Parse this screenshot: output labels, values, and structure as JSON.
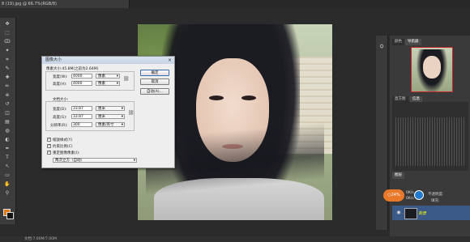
{
  "document": {
    "tab_title": "8 (19).jpg @ 66.7%(RGB/8)",
    "status_text": "文档:7.00M/7.00M"
  },
  "dialog": {
    "title": "图像大小",
    "close_label": "×",
    "pixel_dimensions_label": "像素大小:45.8M(之前为2.64M)",
    "width_label": "宽度(W):",
    "width_value": "4000",
    "width_unit": "像素",
    "height_label": "高度(H):",
    "height_value": "4000",
    "height_unit": "像素",
    "doc_size_label": "文档大小:",
    "doc_width_label": "宽度(D):",
    "doc_width_value": "33.87",
    "doc_width_unit": "厘米",
    "doc_height_label": "高度(G):",
    "doc_height_value": "33.87",
    "doc_height_unit": "厘米",
    "resolution_label": "分辨率(R):",
    "resolution_value": "300",
    "resolution_unit": "像素/英寸",
    "ok_label": "确定",
    "cancel_label": "取消",
    "auto_label": "自动(A)...",
    "scale_styles_label": "缩放样式(Y)",
    "constrain_label": "约束比例(C)",
    "resample_label": "重定图像像素(I):",
    "resample_method": "两次立方（自动）",
    "checked_mark": "✓"
  },
  "panels": {
    "tab_color": "颜色",
    "tab_navigator": "导航器",
    "tab_histogram": "直方图",
    "tab_info": "信息",
    "size_label": "大小:",
    "layers_tab": "图层",
    "layer_name": "背景",
    "opacity_label": "不透明度:",
    "fill_label": "填充:"
  },
  "badge": {
    "text": "○24%",
    "percent_top": "0K/s",
    "percent_bottom": "0K/s"
  },
  "tools": {
    "icons": [
      "move-icon",
      "marquee-icon",
      "lasso-icon",
      "wand-icon",
      "crop-icon",
      "eyedropper-icon",
      "heal-icon",
      "brush-icon",
      "stamp-icon",
      "history-brush-icon",
      "eraser-icon",
      "gradient-icon",
      "blur-icon",
      "dodge-icon",
      "pen-icon",
      "type-icon",
      "path-select-icon",
      "shape-icon",
      "hand-icon",
      "zoom-icon"
    ],
    "glyphs": [
      "✥",
      "⬚",
      "ↀ",
      "✦",
      "⌗",
      "✎",
      "✚",
      "✏",
      "⎈",
      "↺",
      "◫",
      "▤",
      "◍",
      "◐",
      "✒",
      "T",
      "↖",
      "▭",
      "✋",
      "⚲"
    ]
  },
  "colors": {
    "foreground": "#e07b14",
    "background": "#111111",
    "badge": "#e8792b",
    "layer_selected": "#3c5a88"
  }
}
